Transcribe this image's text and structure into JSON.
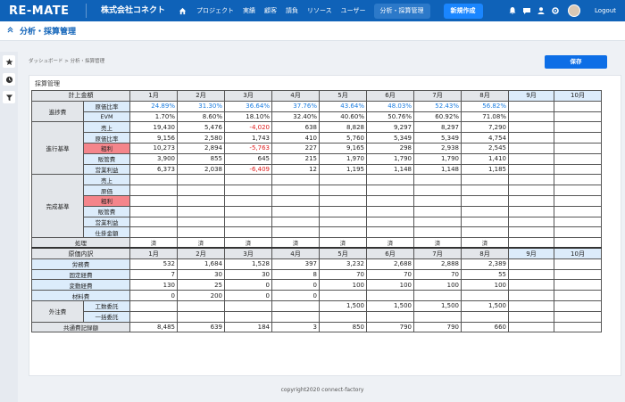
{
  "app": {
    "logo": "RE-MATE",
    "company": "株式会社コネクト",
    "nav": [
      "プロジェクト",
      "実績",
      "顧客",
      "請負",
      "リソース",
      "ユーザー"
    ],
    "active_nav": "分析・採算管理",
    "new_button": "新規作成",
    "logout": "Logout"
  },
  "page": {
    "title": "分析・採算管理",
    "breadcrumb": "ダッシュボード > 分析・採算管理",
    "save_label": "保存",
    "section_title": "採算管理",
    "footer": "copyright2020 connect-factory"
  },
  "months": [
    "1月",
    "2月",
    "3月",
    "4月",
    "5月",
    "6月",
    "7月",
    "8月",
    "9月",
    "10月"
  ],
  "table": {
    "header_label": "計上金額",
    "progress": {
      "group": "進捗費",
      "rows": [
        {
          "label": "原価比率",
          "values": [
            "24.89%",
            "31.30%",
            "36.64%",
            "37.76%",
            "43.64%",
            "48.03%",
            "52.43%",
            "56.82%",
            "",
            ""
          ]
        },
        {
          "label": "EVM",
          "values": [
            "1.70%",
            "8.60%",
            "18.10%",
            "32.40%",
            "40.60%",
            "50.76%",
            "60.92%",
            "71.08%",
            "",
            ""
          ]
        }
      ]
    },
    "progress_basis": {
      "group": "進行基準",
      "rows": [
        {
          "label": "売上",
          "values": [
            "19,430",
            "5,476",
            "-4,020",
            "638",
            "8,828",
            "9,297",
            "8,297",
            "7,290",
            "",
            ""
          ]
        },
        {
          "label": "原価比率",
          "values": [
            "9,156",
            "2,580",
            "1,743",
            "410",
            "5,760",
            "5,349",
            "5,349",
            "4,754",
            "",
            ""
          ]
        },
        {
          "label": "粗利",
          "values": [
            "10,273",
            "2,894",
            "-5,763",
            "227",
            "9,165",
            "298",
            "2,938",
            "2,545",
            "",
            ""
          ]
        },
        {
          "label": "販管費",
          "values": [
            "3,900",
            "855",
            "645",
            "215",
            "1,970",
            "1,790",
            "1,790",
            "1,410",
            "",
            ""
          ]
        },
        {
          "label": "営業利益",
          "values": [
            "6,373",
            "2,038",
            "-6,409",
            "12",
            "1,195",
            "1,148",
            "1,148",
            "1,185",
            "",
            ""
          ]
        }
      ]
    },
    "completion_basis": {
      "group": "完成基準",
      "rows": [
        {
          "label": "売上"
        },
        {
          "label": "原価"
        },
        {
          "label": "粗利"
        },
        {
          "label": "販管費"
        },
        {
          "label": "営業利益"
        },
        {
          "label": "仕掛金額"
        }
      ]
    },
    "processing": {
      "label": "処理",
      "values": [
        "済",
        "済",
        "済",
        "済",
        "済",
        "済",
        "済",
        "済",
        "",
        ""
      ]
    },
    "cost_header_label": "原価内訳",
    "cost": [
      {
        "label": "労務費",
        "values": [
          "532",
          "1,684",
          "1,528",
          "397",
          "3,232",
          "2,688",
          "2,888",
          "2,389",
          "",
          ""
        ]
      },
      {
        "label": "固定経費",
        "values": [
          "7",
          "30",
          "30",
          "8",
          "70",
          "70",
          "70",
          "55",
          "",
          ""
        ]
      },
      {
        "label": "変動経費",
        "values": [
          "130",
          "25",
          "0",
          "0",
          "100",
          "100",
          "100",
          "100",
          "",
          ""
        ]
      },
      {
        "label": "材料費",
        "values": [
          "0",
          "200",
          "0",
          "0",
          "",
          "",
          "",
          "",
          "",
          ""
        ]
      }
    ],
    "outsourcing": {
      "group": "外注費",
      "rows": [
        {
          "label": "工数委託",
          "values": [
            "",
            "",
            "",
            "",
            "1,500",
            "1,500",
            "1,500",
            "1,500",
            "",
            ""
          ]
        },
        {
          "label": "一括委託",
          "values": [
            "",
            "",
            "",
            "",
            "",
            "",
            "",
            "",
            "",
            ""
          ]
        }
      ]
    },
    "common": {
      "label": "共通費記録額",
      "values": [
        "8,485",
        "639",
        "184",
        "3",
        "850",
        "790",
        "790",
        "660",
        "",
        ""
      ]
    }
  }
}
